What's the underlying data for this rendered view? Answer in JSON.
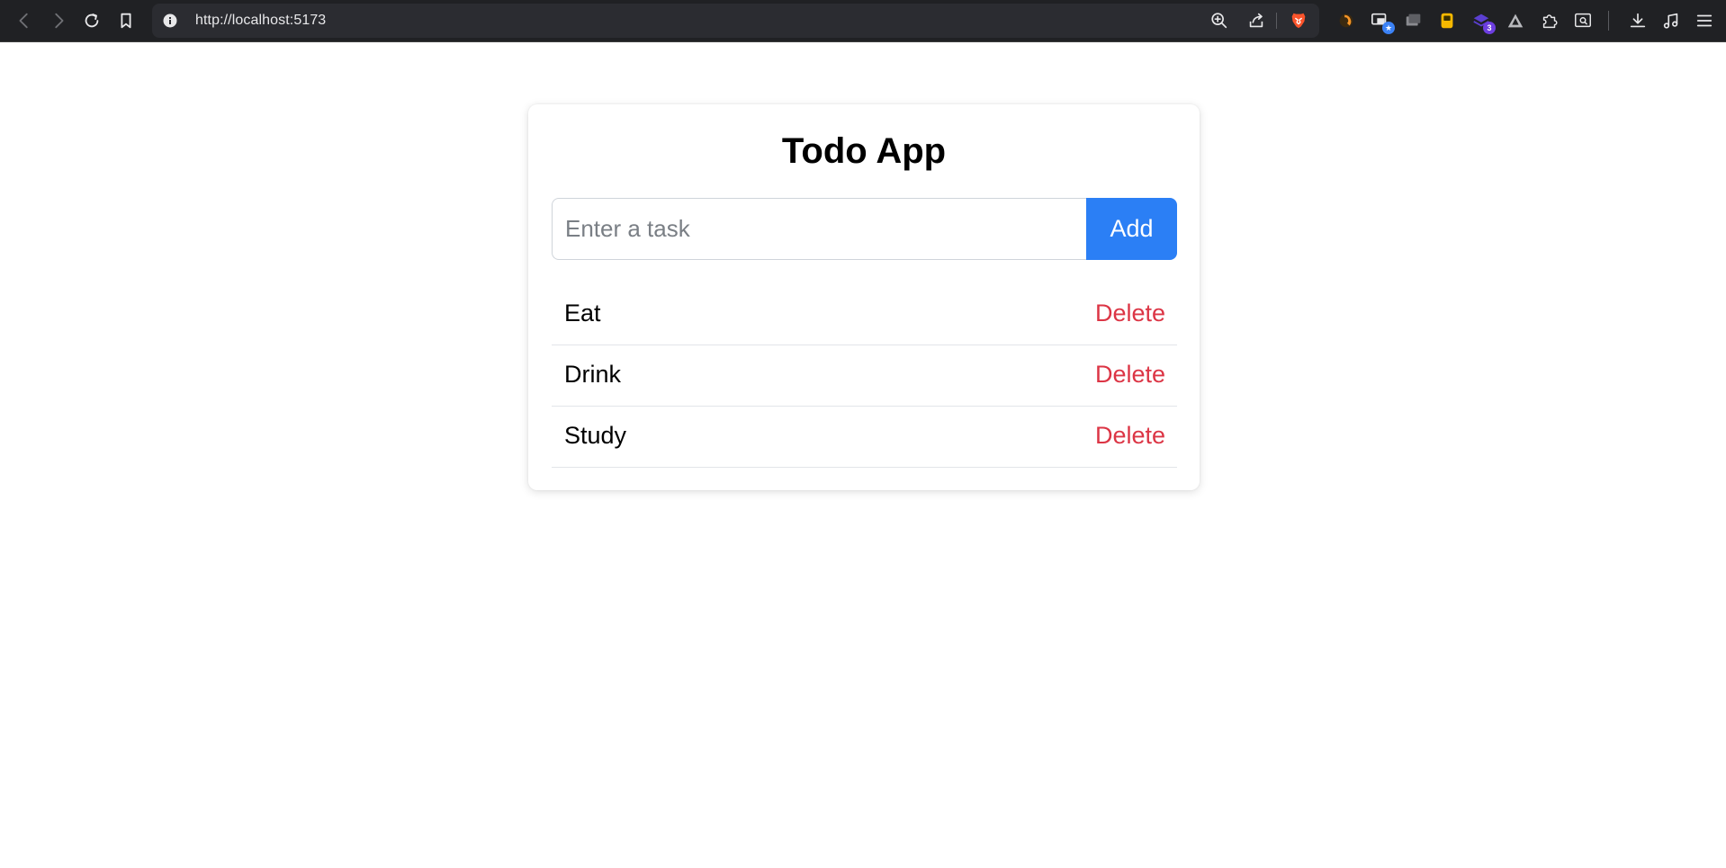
{
  "browser": {
    "url": "http://localhost:5173",
    "extensions": [
      {
        "name": "leo-ai-icon"
      },
      {
        "name": "picture-in-picture-icon",
        "badge": "★"
      },
      {
        "name": "tab-manager-icon"
      },
      {
        "name": "clipboard-icon"
      },
      {
        "name": "layers-icon",
        "badge": "3"
      },
      {
        "name": "triangle-icon"
      },
      {
        "name": "extensions-puzzle-icon"
      },
      {
        "name": "search-page-icon"
      }
    ],
    "colors": {
      "bar": "#202124",
      "address": "#2b2c31",
      "brave": "#fb542b"
    }
  },
  "app": {
    "title": "Todo App",
    "input": {
      "placeholder": "Enter a task",
      "value": ""
    },
    "add_label": "Add",
    "tasks": [
      {
        "text": "Eat",
        "delete_label": "Delete"
      },
      {
        "text": "Drink",
        "delete_label": "Delete"
      },
      {
        "text": "Study",
        "delete_label": "Delete"
      }
    ],
    "colors": {
      "accent": "#2b7ff5",
      "danger": "#dc3545"
    }
  }
}
